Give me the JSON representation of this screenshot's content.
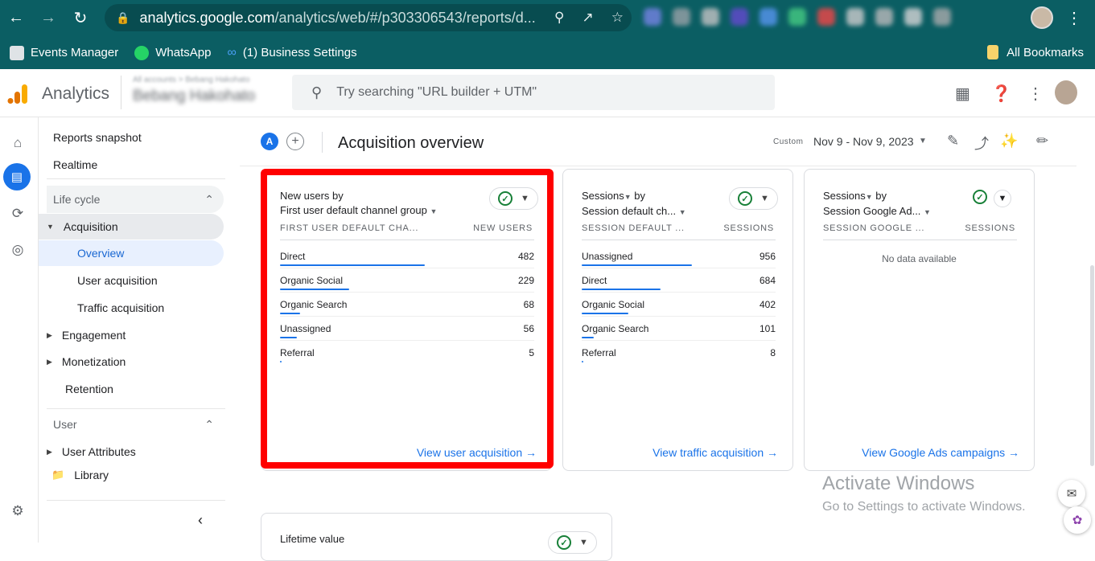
{
  "browser": {
    "url_main": "analytics.google.com",
    "url_rest": "/analytics/web/#/p303306543/reports/d...",
    "bookmarks": [
      "Events Manager",
      "WhatsApp",
      "(1) Business Settings"
    ],
    "all_bookmarks": "All Bookmarks"
  },
  "header": {
    "app_name": "Analytics",
    "account_small": "All accounts > Bebang Hakohato",
    "account_name": "Bebang Hakohato",
    "search_placeholder": "Try searching \"URL builder + UTM\""
  },
  "sidebar": {
    "reports_snapshot": "Reports snapshot",
    "realtime": "Realtime",
    "lifecycle": "Life cycle",
    "acquisition": "Acquisition",
    "overview": "Overview",
    "user_acquisition": "User acquisition",
    "traffic_acquisition": "Traffic acquisition",
    "engagement": "Engagement",
    "monetization": "Monetization",
    "retention": "Retention",
    "user": "User",
    "user_attributes": "User Attributes",
    "library": "Library"
  },
  "page": {
    "title": "Acquisition overview",
    "badge": "A",
    "date_label": "Custom",
    "date_range": "Nov 9 - Nov 9, 2023"
  },
  "cards": [
    {
      "title_1": "New users by",
      "title_2": "First user default channel group",
      "col_left": "FIRST USER DEFAULT CHA...",
      "col_right": "NEW USERS",
      "rows": [
        {
          "label": "Direct",
          "value": "482",
          "frac": 1.0
        },
        {
          "label": "Organic Social",
          "value": "229",
          "frac": 0.475
        },
        {
          "label": "Organic Search",
          "value": "68",
          "frac": 0.141
        },
        {
          "label": "Unassigned",
          "value": "56",
          "frac": 0.116
        },
        {
          "label": "Referral",
          "value": "5",
          "frac": 0.01
        }
      ],
      "link": "View user acquisition"
    },
    {
      "title_1": "Sessions",
      "title_1b": "by",
      "title_2": "Session default ch...",
      "col_left": "SESSION DEFAULT ...",
      "col_right": "SESSIONS",
      "rows": [
        {
          "label": "Unassigned",
          "value": "956",
          "frac": 1.0
        },
        {
          "label": "Direct",
          "value": "684",
          "frac": 0.715
        },
        {
          "label": "Organic Social",
          "value": "402",
          "frac": 0.42
        },
        {
          "label": "Organic Search",
          "value": "101",
          "frac": 0.106
        },
        {
          "label": "Referral",
          "value": "8",
          "frac": 0.008
        }
      ],
      "link": "View traffic acquisition"
    },
    {
      "title_1": "Sessions",
      "title_1b": "by",
      "title_2": "Session Google Ad...",
      "col_left": "SESSION GOOGLE ...",
      "col_right": "SESSIONS",
      "no_data": "No data available",
      "link": "View Google Ads campaigns"
    }
  ],
  "lifetime_card": {
    "title": "Lifetime value"
  },
  "watermark": {
    "line1": "Activate Windows",
    "line2": "Go to Settings to activate Windows."
  }
}
